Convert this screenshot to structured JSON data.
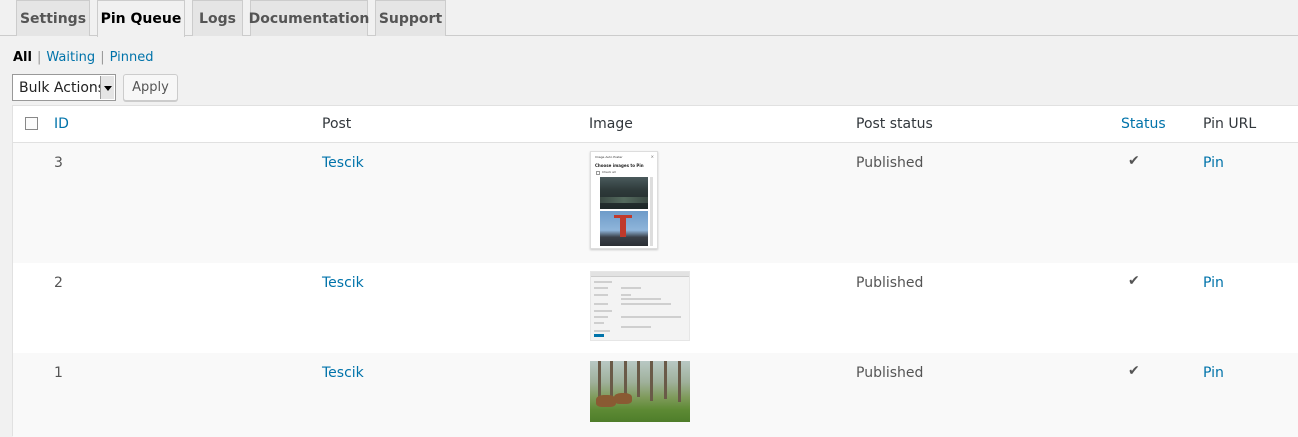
{
  "tabs": [
    {
      "label": "Settings",
      "active": false
    },
    {
      "label": "Pin Queue",
      "active": true
    },
    {
      "label": "Logs",
      "active": false
    },
    {
      "label": "Documentation",
      "active": false
    },
    {
      "label": "Support",
      "active": false
    }
  ],
  "filters": {
    "all": "All",
    "waiting": "Waiting",
    "pinned": "Pinned",
    "separator": "|"
  },
  "bulk_actions": {
    "selected": "Bulk Actions",
    "apply_label": "Apply"
  },
  "table": {
    "columns": {
      "id": "ID",
      "post": "Post",
      "image": "Image",
      "post_status": "Post status",
      "status": "Status",
      "pin_url": "Pin URL"
    },
    "rows": [
      {
        "id": "3",
        "post": "Tescik",
        "post_status": "Published",
        "status_icon": "checkmark-icon",
        "status_glyph": "✔",
        "pin_url": "Pin"
      },
      {
        "id": "2",
        "post": "Tescik",
        "post_status": "Published",
        "status_icon": "checkmark-icon",
        "status_glyph": "✔",
        "pin_url": "Pin"
      },
      {
        "id": "1",
        "post": "Tescik",
        "post_status": "Published",
        "status_icon": "checkmark-icon",
        "status_glyph": "✔",
        "pin_url": "Pin"
      }
    ]
  },
  "thumbnail_1": {
    "title": "Image Auto Poster",
    "close": "×",
    "heading": "Choose images to Pin",
    "check_all": "Check all"
  },
  "colors": {
    "link": "#0073aa",
    "background": "#f1f1f1",
    "table_background": "#ffffff",
    "alt_row": "#f9f9f9"
  }
}
